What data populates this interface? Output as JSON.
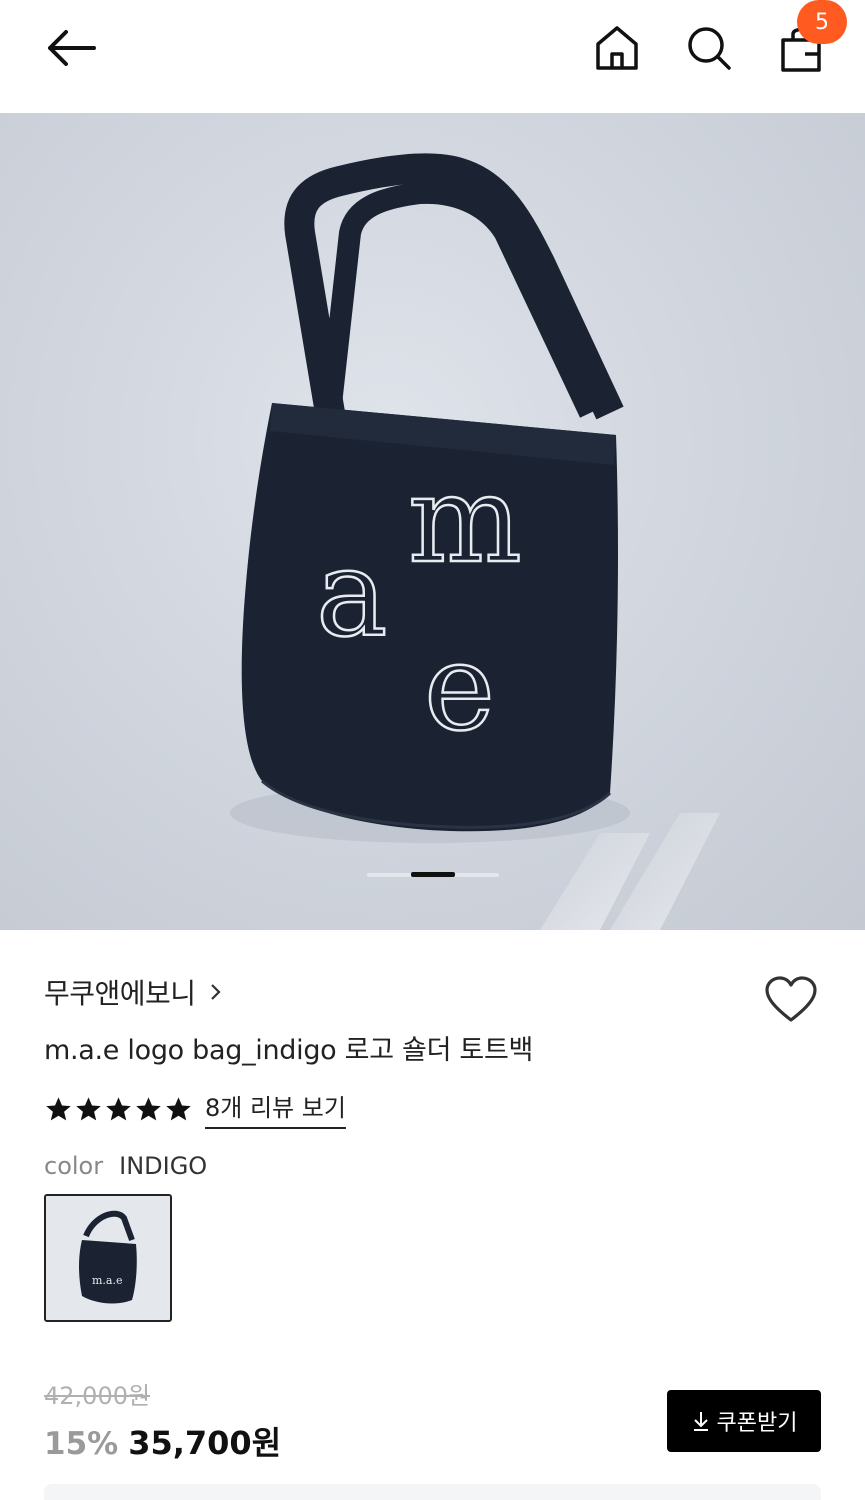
{
  "header": {
    "cart_count": "5"
  },
  "gallery": {
    "image_label": "m.a.e logo tote bag in indigo",
    "bag_letters": {
      "m": "m",
      "a": "a",
      "e": "e"
    },
    "current_slide": 2,
    "total_slides": 3
  },
  "product": {
    "brand": "무쿠앤에보니",
    "title": "m.a.e logo bag_indigo 로고 숄더 토트백",
    "rating_stars": 5,
    "review_link": "8개 리뷰 보기",
    "option_label": "color",
    "option_value": "INDIGO",
    "thumb_text": "m.a.e"
  },
  "pricing": {
    "original": "42,000원",
    "discount": "15%",
    "sale": "35,700원",
    "coupon_label": "쿠폰받기"
  },
  "colors": {
    "badge": "#ff5a1f",
    "bag": "#1b2332",
    "coupon_bg": "#000000"
  }
}
